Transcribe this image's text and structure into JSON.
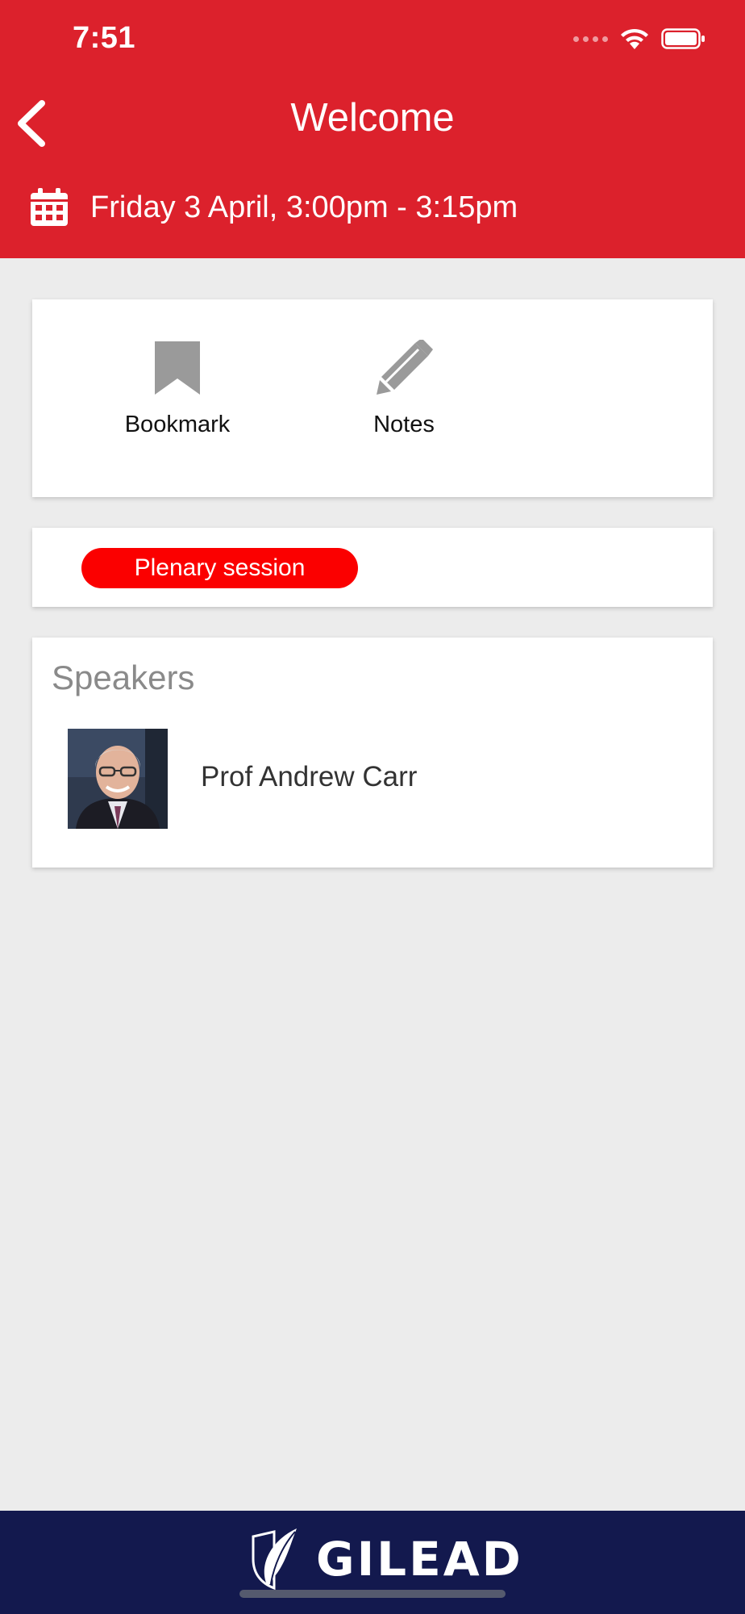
{
  "status_bar": {
    "time": "7:51"
  },
  "header": {
    "title": "Welcome",
    "date_time": "Friday 3 April, 3:00pm - 3:15pm"
  },
  "actions": {
    "bookmark_label": "Bookmark",
    "notes_label": "Notes"
  },
  "session": {
    "type_label": "Plenary session"
  },
  "speakers": {
    "title": "Speakers",
    "items": [
      {
        "name": "Prof Andrew Carr"
      }
    ]
  },
  "footer": {
    "brand": "GILEAD"
  },
  "colors": {
    "header_red": "#dc212c",
    "pill_red": "#fb0000",
    "footer_navy": "#13194e",
    "icon_gray": "#9a9a9a"
  }
}
